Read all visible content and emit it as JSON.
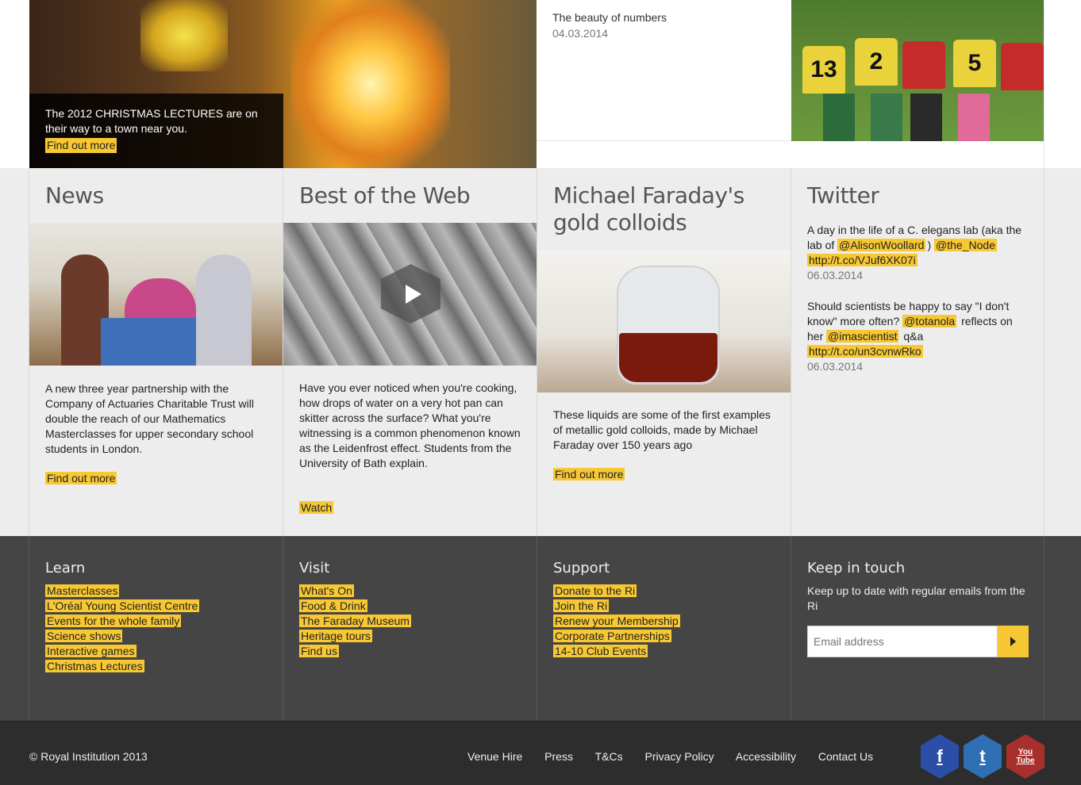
{
  "hero": {
    "caption": "The 2012 CHRISTMAS LECTURES are on their way to a town near you.",
    "cta": "Find out more"
  },
  "feature": {
    "title": "The beauty of numbers",
    "date": "04.03.2014"
  },
  "kids_numbers": [
    "13",
    "2",
    "5"
  ],
  "news": {
    "heading": "News",
    "text": "A new three year partnership with the Company of Actuaries Charitable Trust will double the reach of our Mathematics Masterclasses for upper secondary school students in London.",
    "cta": "Find out more"
  },
  "web": {
    "heading": "Best of the Web",
    "text": "Have you ever noticed when you're cooking, how drops of water on a very hot pan can skitter across the surface? What you're witnessing is a common phenomenon known as the Leidenfrost effect. Students from the University of Bath explain.",
    "cta": "Watch"
  },
  "faraday": {
    "heading": "Michael Faraday's gold colloids",
    "text": "These liquids are some of the first examples of metallic gold colloids, made by Michael Faraday over 150 years ago",
    "cta": "Find out more"
  },
  "twitter": {
    "heading": "Twitter",
    "tweets": [
      {
        "pre": "A day in the life of a C. elegans lab (aka the lab of",
        "mention1": "@AlisonWoollard",
        "mid": ")",
        "mention2": "@the_Node",
        "link": "http://t.co/VJuf6XK07i",
        "date": "06.03.2014"
      },
      {
        "pre": "Should scientists be happy to say \"I don't know\" more often?",
        "mention1": "@totanola",
        "mid": "reflects on her",
        "mention2": "@imascientist",
        "post": "q&a",
        "link": "http://t.co/un3cvnwRko",
        "date": "06.03.2014"
      }
    ]
  },
  "footer": {
    "learn": {
      "heading": "Learn",
      "links": [
        "Masterclasses",
        "L'Oréal Young Scientist Centre",
        "Events for the whole family",
        "Science shows",
        "Interactive games",
        "Christmas Lectures"
      ]
    },
    "visit": {
      "heading": "Visit",
      "links": [
        "What's On",
        "Food & Drink",
        "The Faraday Museum",
        "Heritage tours",
        "Find us"
      ]
    },
    "support": {
      "heading": "Support",
      "links": [
        "Donate to the Ri",
        "Join the Ri",
        "Renew your Membership",
        "Corporate Partnerships",
        "14-10 Club Events"
      ]
    },
    "keep": {
      "heading": "Keep in touch",
      "text": "Keep up to date with regular emails from the Ri",
      "placeholder": "Email address"
    }
  },
  "bottom": {
    "copyright": "© Royal Institution 2013",
    "links": [
      "Venue Hire",
      "Press",
      "T&Cs",
      "Privacy Policy",
      "Accessibility",
      "Contact Us"
    ],
    "social": [
      {
        "icon": "facebook-icon",
        "glyph": "f",
        "color": "#2b4fa6"
      },
      {
        "icon": "twitter-icon",
        "glyph": "t",
        "color": "#2f6fb3"
      },
      {
        "icon": "youtube-icon",
        "glyph": "You Tube",
        "color": "#a8302c"
      }
    ]
  },
  "colors": {
    "highlight": "#f7c833",
    "footer_bg": "#454545",
    "bottom_bg": "#2d2d2d",
    "mid_bg": "#ededed"
  }
}
